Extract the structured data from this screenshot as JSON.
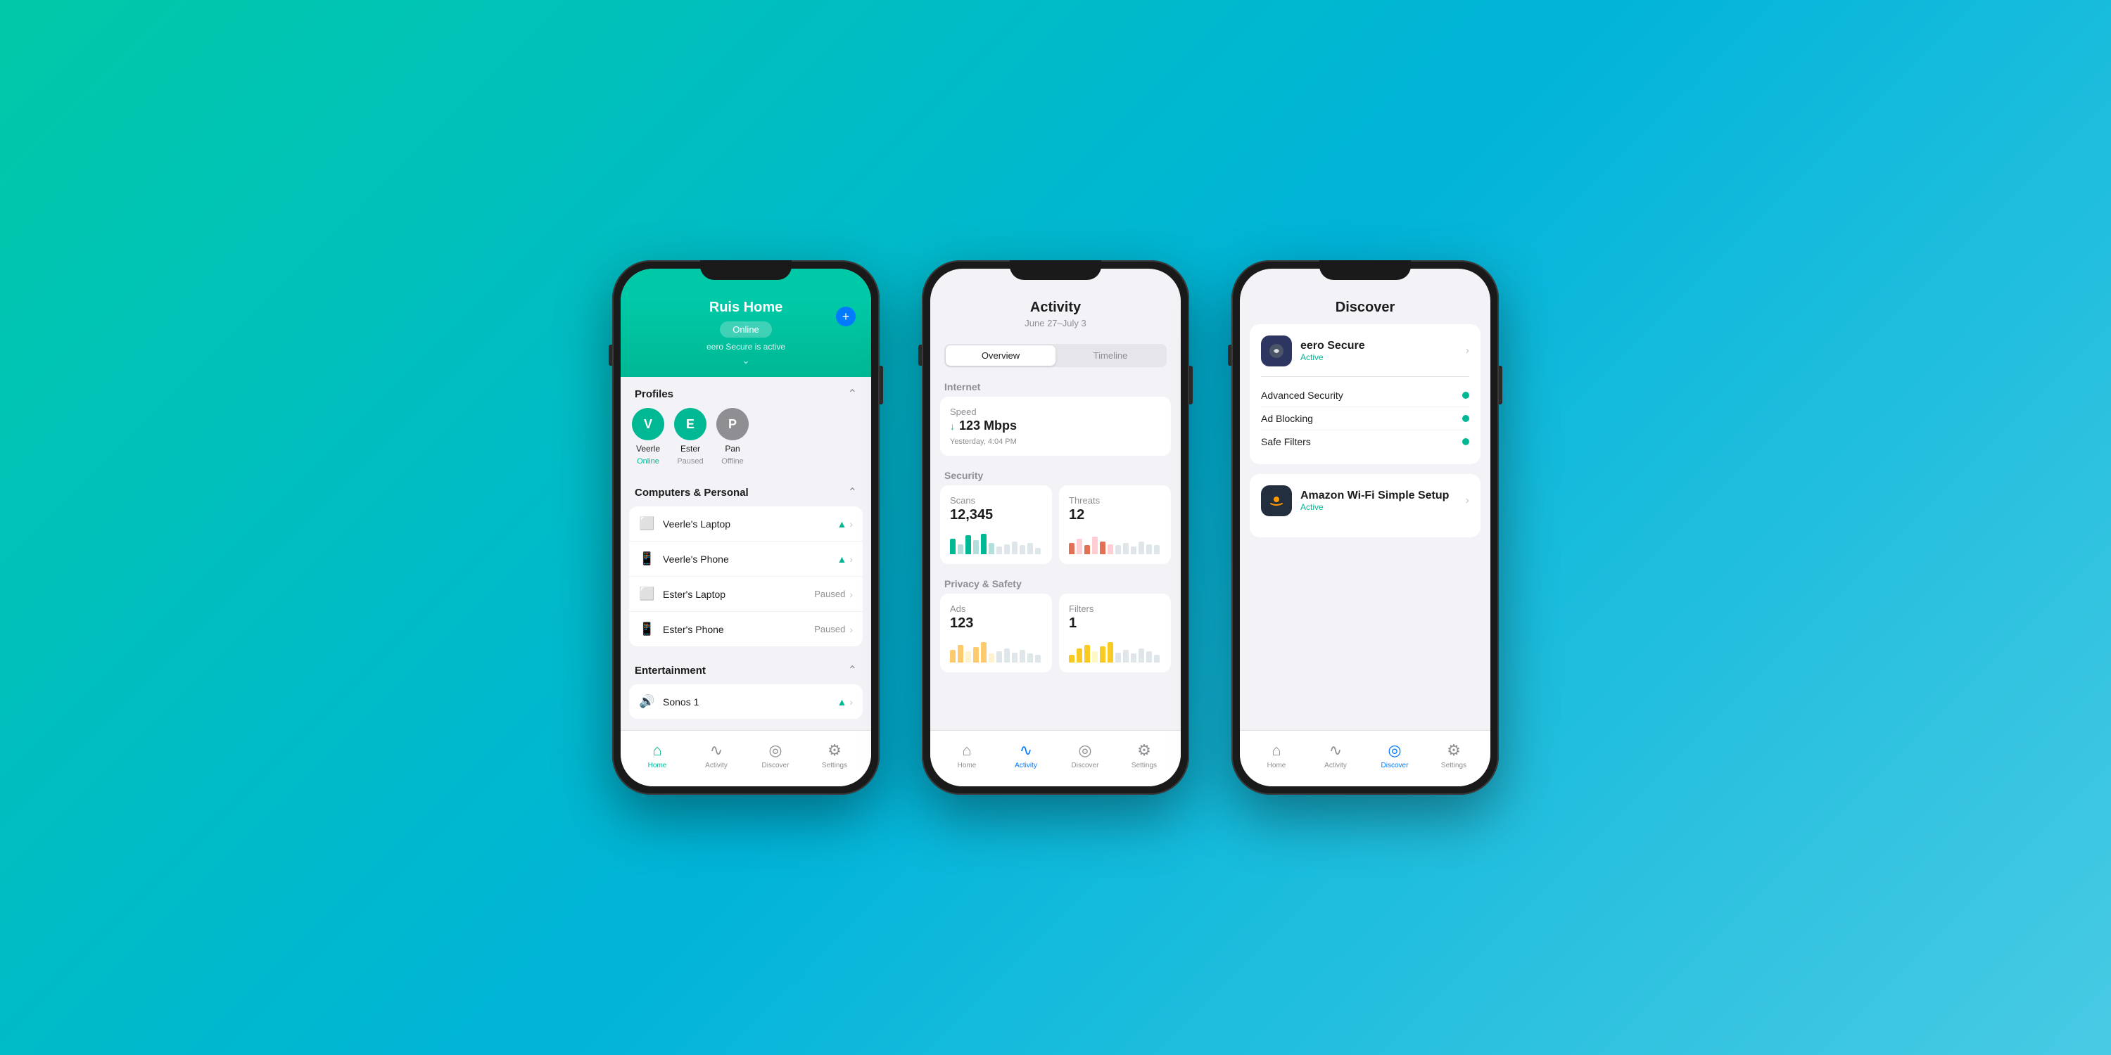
{
  "background": {
    "gradient_start": "#00c9a7",
    "gradient_end": "#48cae4"
  },
  "phone1": {
    "header": {
      "title": "Ruis Home",
      "status": "Online",
      "subtitle": "eero Secure is active",
      "plus_label": "+"
    },
    "profiles_section": {
      "title": "Profiles",
      "profiles": [
        {
          "initial": "V",
          "name": "Veerle",
          "status": "Online",
          "color": "green"
        },
        {
          "initial": "E",
          "name": "Ester",
          "status": "Paused",
          "color": "teal"
        },
        {
          "initial": "P",
          "name": "Pan",
          "status": "Offline",
          "color": "gray"
        }
      ]
    },
    "computers_section": {
      "title": "Computers & Personal",
      "devices": [
        {
          "name": "Veerle's Laptop",
          "status": "wifi",
          "icon": "laptop"
        },
        {
          "name": "Veerle's Phone",
          "status": "wifi",
          "icon": "phone"
        },
        {
          "name": "Ester's Laptop",
          "status": "Paused",
          "icon": "laptop"
        },
        {
          "name": "Ester's Phone",
          "status": "Paused",
          "icon": "phone"
        }
      ]
    },
    "entertainment_section": {
      "title": "Entertainment",
      "devices": [
        {
          "name": "Sonos 1",
          "status": "wifi",
          "icon": "speaker"
        }
      ]
    },
    "nav": {
      "items": [
        {
          "label": "Home",
          "active": true
        },
        {
          "label": "Activity",
          "active": false
        },
        {
          "label": "Discover",
          "active": false
        },
        {
          "label": "Settings",
          "active": false
        }
      ]
    }
  },
  "phone2": {
    "header": {
      "title": "Activity",
      "date_range": "June 27–July 3"
    },
    "tabs": [
      {
        "label": "Overview",
        "active": true
      },
      {
        "label": "Timeline",
        "active": false
      }
    ],
    "internet_section": {
      "label": "Internet",
      "speed": {
        "label": "Speed",
        "value": "↓123 Mbps",
        "timestamp": "Yesterday, 4:04 PM"
      }
    },
    "security_section": {
      "label": "Security",
      "scans": {
        "label": "Scans",
        "value": "12,345",
        "bars": [
          60,
          40,
          75,
          55,
          80,
          45,
          30,
          65,
          50,
          70,
          40,
          25
        ]
      },
      "threats": {
        "label": "Threats",
        "value": "12",
        "bars": [
          45,
          60,
          35,
          70,
          50,
          40,
          65,
          55,
          30,
          45,
          60,
          35
        ]
      }
    },
    "privacy_section": {
      "label": "Privacy & Safety",
      "ads": {
        "label": "Ads",
        "value": "123",
        "bars": [
          50,
          70,
          45,
          60,
          80,
          35,
          55,
          65,
          40,
          70,
          50,
          30
        ]
      },
      "filters": {
        "label": "Filters",
        "value": "1",
        "bars": [
          30,
          55,
          70,
          45,
          65,
          80,
          40,
          60,
          35,
          50,
          75,
          45
        ]
      }
    },
    "nav": {
      "items": [
        {
          "label": "Home",
          "active": false
        },
        {
          "label": "Activity",
          "active": true
        },
        {
          "label": "Discover",
          "active": false
        },
        {
          "label": "Settings",
          "active": false
        }
      ]
    }
  },
  "phone3": {
    "header": {
      "title": "Discover"
    },
    "eero_secure": {
      "app_name": "eero Secure",
      "app_status": "Active",
      "features": [
        {
          "name": "Advanced Security",
          "active": true
        },
        {
          "name": "Ad Blocking",
          "active": true
        },
        {
          "name": "Safe Filters",
          "active": true
        }
      ]
    },
    "amazon_wifi": {
      "app_name": "Amazon Wi-Fi Simple Setup",
      "app_status": "Active"
    },
    "nav": {
      "items": [
        {
          "label": "Home",
          "active": false
        },
        {
          "label": "Activity",
          "active": false
        },
        {
          "label": "Discover",
          "active": true
        },
        {
          "label": "Settings",
          "active": false
        }
      ]
    }
  }
}
